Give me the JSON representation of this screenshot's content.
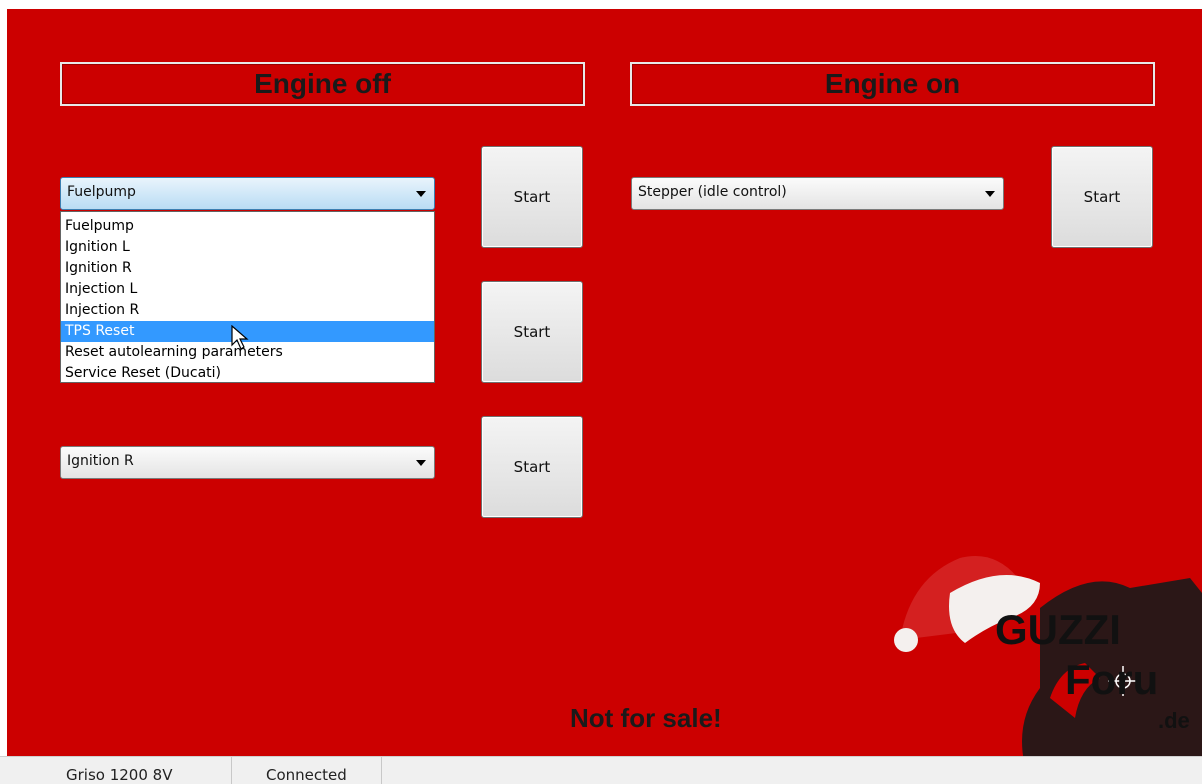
{
  "headers": {
    "engine_off": "Engine off",
    "engine_on": "Engine on"
  },
  "engine_off": {
    "combo1": {
      "selected": "Fuelpump"
    },
    "combo3": {
      "selected": "Ignition R"
    },
    "dropdown_options": [
      "Fuelpump",
      "Ignition L",
      "Ignition R",
      "Injection L",
      "Injection R",
      "TPS Reset",
      "Reset autolearning parameters",
      "Service Reset (Ducati)"
    ],
    "highlighted_option": "TPS Reset",
    "start_labels": [
      "Start",
      "Start",
      "Start"
    ]
  },
  "engine_on": {
    "combo": {
      "selected": "Stepper (idle control)"
    },
    "start_label": "Start"
  },
  "notice": "Not for sale!",
  "status": {
    "model": "Griso 1200 8V",
    "connection": "Connected"
  },
  "logo": {
    "line1": "GUZZI",
    "line2": "Foru",
    "line3": ".de"
  },
  "colors": {
    "background": "#cc0000",
    "highlight": "#3399ff"
  }
}
